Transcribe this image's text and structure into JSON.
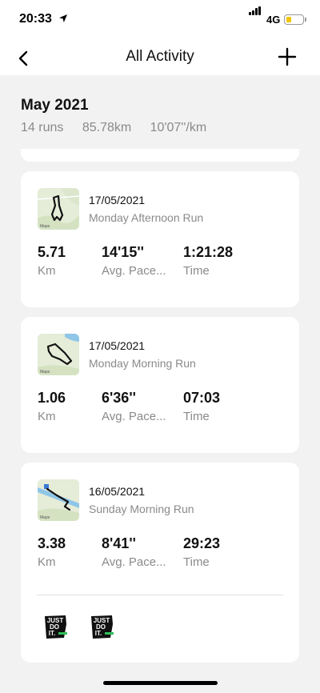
{
  "status": {
    "time": "20:33",
    "network": "4G"
  },
  "nav": {
    "title": "All Activity"
  },
  "summary": {
    "month": "May 2021",
    "runs": "14 runs",
    "distance": "85.78km",
    "pace": "10'07''/km"
  },
  "activities": [
    {
      "date": "17/05/2021",
      "name": "Monday Afternoon Run",
      "distance": "5.71",
      "distance_label": "Km",
      "pace": "14'15''",
      "pace_label": "Avg. Pace...",
      "time": "1:21:28",
      "time_label": "Time",
      "map_label": "Maps"
    },
    {
      "date": "17/05/2021",
      "name": "Monday Morning Run",
      "distance": "1.06",
      "distance_label": "Km",
      "pace": "6'36''",
      "pace_label": "Avg. Pace...",
      "time": "07:03",
      "time_label": "Time",
      "map_label": "Maps"
    },
    {
      "date": "16/05/2021",
      "name": "Sunday Morning Run",
      "distance": "3.38",
      "distance_label": "Km",
      "pace": "8'41''",
      "pace_label": "Avg. Pace...",
      "time": "29:23",
      "time_label": "Time",
      "map_label": "Maps"
    }
  ],
  "badges": [
    {
      "icon": "just-do-it-badge"
    },
    {
      "icon": "just-do-it-badge"
    }
  ],
  "colors": {
    "accent": "#f2c300",
    "map_land": "#e4ecd8",
    "map_water": "#8fc6e8"
  }
}
